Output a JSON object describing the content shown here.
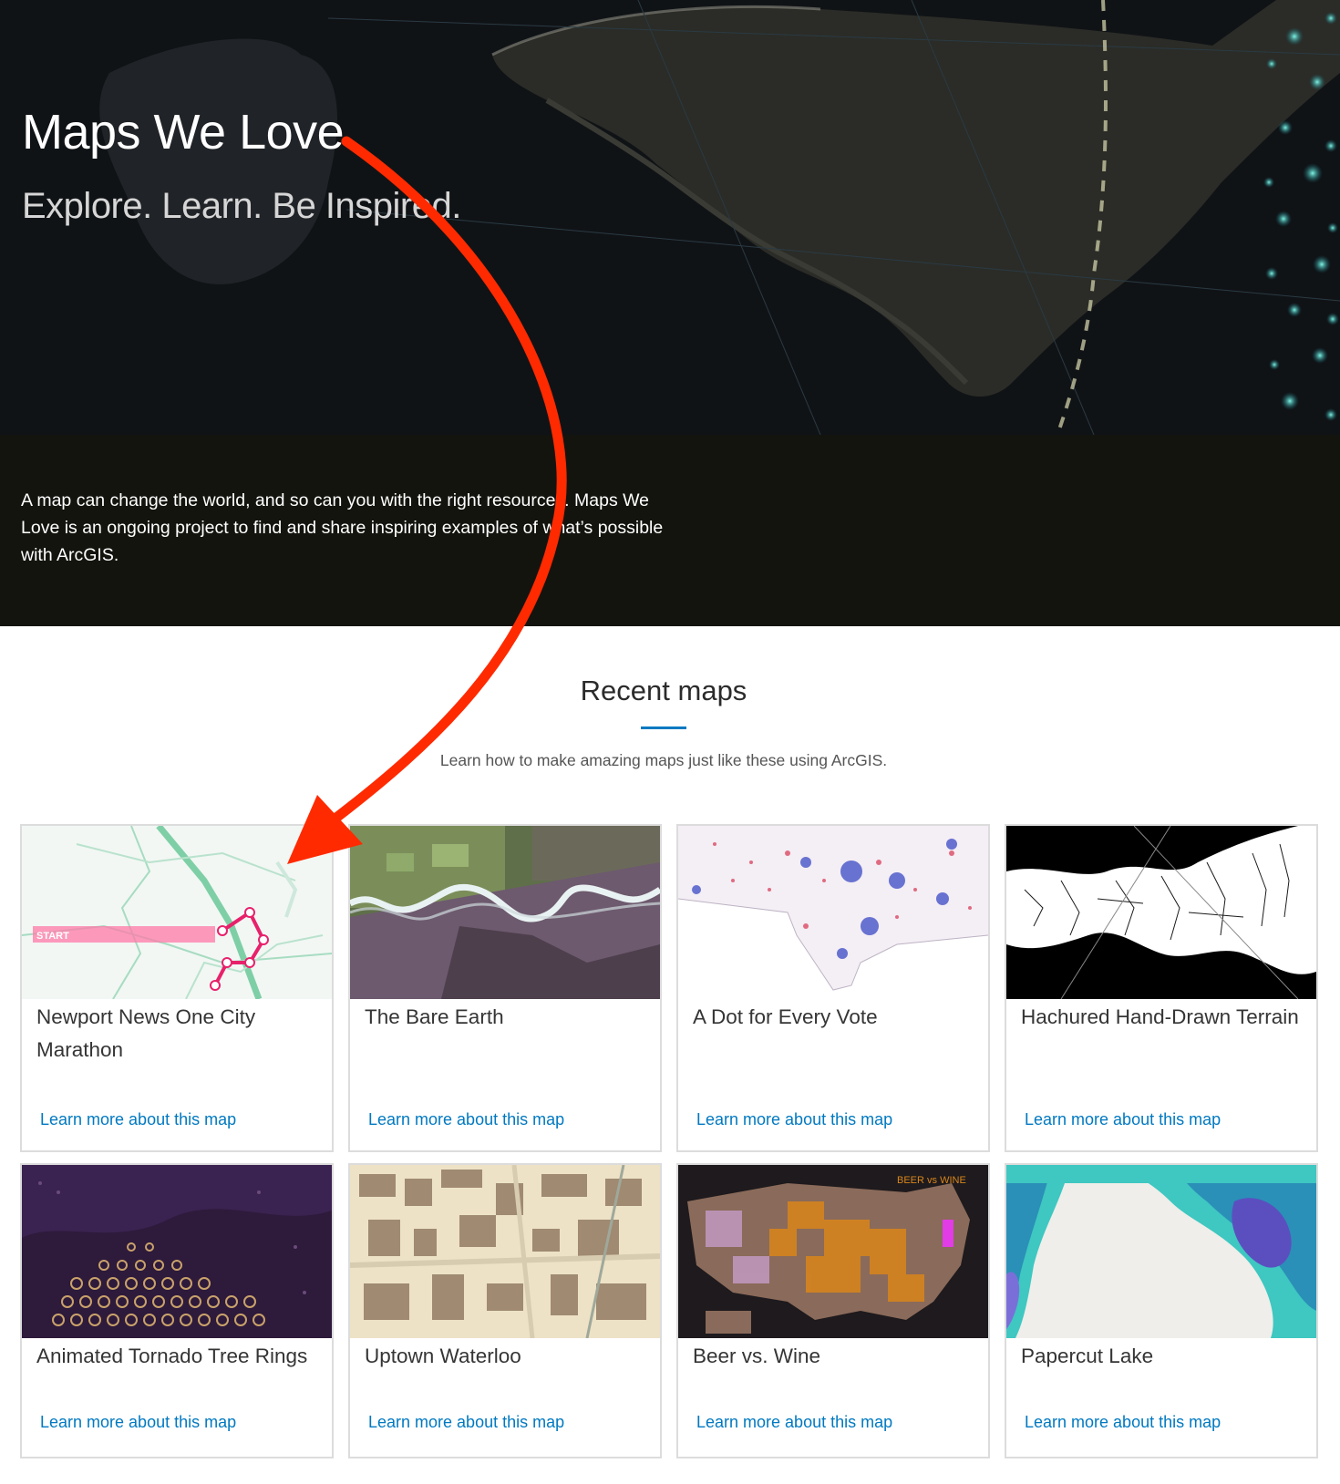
{
  "hero": {
    "title": "Maps We Love",
    "subtitle": "Explore. Learn. Be Inspired."
  },
  "intro": {
    "text": "A map can change the world, and so can you with the right resources. Maps We Love is an ongoing project to find and share inspiring examples of what’s possible with ArcGIS."
  },
  "recent": {
    "title": "Recent maps",
    "subtitle": "Learn how to make amazing maps just like these using ArcGIS.",
    "accent_color": "#0079c1"
  },
  "cards": [
    {
      "title": "Newport News One City Marathon",
      "link": "Learn more about this map",
      "thumb_label": "START"
    },
    {
      "title": "The Bare Earth",
      "link": "Learn more about this map"
    },
    {
      "title": "A Dot for Every Vote",
      "link": "Learn more about this map"
    },
    {
      "title": "Hachured Hand-Drawn Terrain",
      "link": "Learn more about this map"
    },
    {
      "title": "Animated Tornado Tree Rings",
      "link": "Learn more about this map"
    },
    {
      "title": "Uptown Waterloo",
      "link": "Learn more about this map"
    },
    {
      "title": "Beer vs. Wine",
      "link": "Learn more about this map",
      "thumb_label": "BEER vs WINE"
    },
    {
      "title": "Papercut Lake",
      "link": "Learn more about this map"
    }
  ],
  "annotation": {
    "arrow_color": "#ff2a00"
  }
}
